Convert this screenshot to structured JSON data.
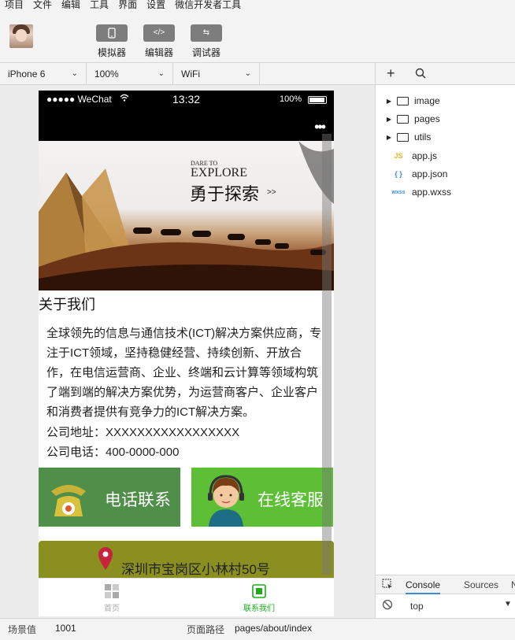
{
  "menu": [
    "项目",
    "文件",
    "编辑",
    "工具",
    "界面",
    "设置",
    "微信开发者工具"
  ],
  "toolbar": {
    "simulator_label": "模拟器",
    "editor_label": "编辑器",
    "debugger_label": "调试器"
  },
  "selectors": {
    "device": "iPhone 6",
    "zoom": "100%",
    "network": "WiFi"
  },
  "phone": {
    "carrier": "●●●●● WeChat",
    "time": "13:32",
    "battery": "100%",
    "more_dots": "•••",
    "banner": {
      "dare_to": "DARE TO",
      "explore": "EXPLORE",
      "slogan": "勇于探索",
      "arrows": ">>"
    },
    "about_title": "关于我们",
    "intro_text": "全球领先的信息与通信技术(ICT)解决方案供应商，专注于ICT领域，坚持稳健经营、持续创新、开放合作，在电信运营商、企业、终端和云计算等领域构筑了端到端的解决方案优势，为运营商客户、企业客户和消费者提供有竞争力的ICT解决方案。",
    "address_line": "公司地址：XXXXXXXXXXXXXXXXX",
    "phone_line": "公司电话：400-0000-000",
    "phone_button": "电话联系",
    "service_button": "在线客服",
    "address_bar": "深圳市宝岗区小林村50号",
    "tabs": [
      {
        "label": "首页",
        "active": false
      },
      {
        "label": "联系我们",
        "active": true
      }
    ]
  },
  "file_tree": [
    {
      "name": "image",
      "type": "folder"
    },
    {
      "name": "pages",
      "type": "folder"
    },
    {
      "name": "utils",
      "type": "folder"
    },
    {
      "name": "app.js",
      "type": "js",
      "badge": "JS"
    },
    {
      "name": "app.json",
      "type": "json",
      "badge": "{ }"
    },
    {
      "name": "app.wxss",
      "type": "wxss",
      "badge": "wxss"
    }
  ],
  "console": {
    "tabs": [
      "Console",
      "Sources",
      "N"
    ],
    "active_tab": "Console",
    "context": "top",
    "prompt": ">"
  },
  "status": {
    "scene_label": "场景值",
    "scene_value": "1001",
    "path_label": "页面路径",
    "path_value": "pages/about/index"
  },
  "colors": {
    "phone_btn": "#4f8f4a",
    "service_btn": "#5cbf36",
    "address_bar": "#8b8f1f",
    "active_tab": "#1aad19"
  }
}
